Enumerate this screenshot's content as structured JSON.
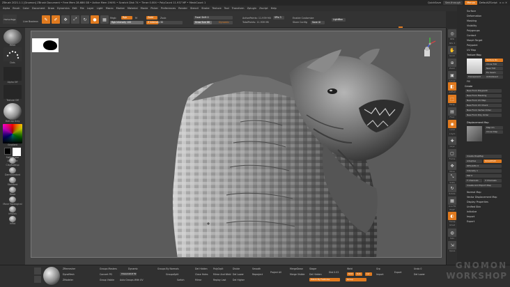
{
  "titlebar": {
    "title": "ZBrush 2021.1.1 [Gnomon]   ZBrush Document   • Free Mem 28.686 GB • Active Mem 19491 • Scratch Disk 74 • Timer 0.004 • PolyCount 11.937 MP • MeshCount 1",
    "quicksave": "QuickSave",
    "transparency": "See-through",
    "menus_btn": "Menus",
    "script": "DefaultZScript"
  },
  "menubar": [
    "Alpha",
    "Brush",
    "Color",
    "Document",
    "Draw",
    "Dynamics",
    "Edit",
    "File",
    "Layer",
    "Light",
    "Macro",
    "Marker",
    "Material",
    "Movie",
    "Picker",
    "Preferences",
    "Render",
    "Stencil",
    "Stroke",
    "Texture",
    "Tool",
    "Transform",
    "Zplugin",
    "Zscript",
    "Help"
  ],
  "topbar": {
    "home": "Home Page",
    "lightbox": "LightBox",
    "live_boolean": "Live Boolean",
    "edit": "Edit",
    "draw": "Draw",
    "move": "Move",
    "scale": "Scale",
    "rotate": "Rotate",
    "mrgb": "Mrgb",
    "rgb": "Rgb",
    "m": "M",
    "rgb_intensity": "Rgb Intensity 100",
    "zadd": "Zadd",
    "zsub": "Zsub",
    "z_intensity": "Z Intensity 32",
    "focal_shift": "Focal Shift 0",
    "draw_size": "Draw Size 86",
    "dynamic": "Dynamic",
    "active_points": "ActivePoints: 11.939 Mil",
    "total_points": "TotalPoints: 11.939 Mil",
    "spix": "SPix 3",
    "enable_customize": "Enable Customize",
    "store_config": "Store Config",
    "save_ui": "Save UI",
    "lightbox_btn": "LightBox"
  },
  "lefttray": {
    "brush": "Move",
    "stroke": "Dots",
    "alpha": "Alpha Off",
    "texture": "Texture Off",
    "material": "MatCap Gray",
    "gradient": "Gradient",
    "switch_color": "SwitchColor",
    "alternate": "Alternate",
    "brushes": [
      "ClayBuildup",
      "DamStandard",
      "Standard",
      "Move",
      "Move Topological",
      "hPolish",
      "Inflat"
    ]
  },
  "rightstrip": [
    "BPR",
    "SPix 3",
    "Scroll",
    "Zoom",
    "Actual",
    "AAHalf",
    "Persp",
    "Floor",
    "Local",
    "L.Sym",
    "Gxyz",
    "Frame",
    "Move",
    "Scale",
    "Rotate",
    "Line Fill",
    "PolyF",
    "Transp",
    "Ghost",
    "Solo",
    "Xpose"
  ],
  "rightpanel": {
    "items": [
      "Surface",
      "Deformation",
      "Masking",
      "Visibility",
      "Polygroups",
      "Contact",
      "Morph Target",
      "Polypaint",
      "UV Map"
    ],
    "texture_map": "Texture Map",
    "texture_on": "Texture On",
    "clone_txtr": "Clone Txtr",
    "new_txtr": "New Txtr",
    "fix_seam": "Fix Seam",
    "transparent": "Transparent",
    "antialiased": "Antialiased",
    "fill": "Fill",
    "create": "Create",
    "create_items": [
      "New From Polypaint",
      "New From Masking",
      "New From UV Map",
      "New From UV Check",
      "New From Vertex Order",
      "New From Poly Order"
    ],
    "displacement_map": "Displacement Map",
    "map_on": "Map On",
    "clone_disp": "Clone Disp",
    "create_dispmap": "Create DispMap",
    "mode": "Mode",
    "adaptive": "Adaptive",
    "smooth_uv": "SmoothUV",
    "dpsubpix": "DPSubPix 0",
    "intensity": "Intensity 1",
    "mid": "Mid 0",
    "f_channels": "F Channels",
    "channels_val": "3 Channels",
    "create_all": "Create And Export Map",
    "normal_map": "Normal Map",
    "vector_disp": "Vector Displacement Map",
    "display_props": "Display Properties",
    "unified_skin": "Unified Skin",
    "initialize": "Initialize",
    "import": "Import",
    "export": "Export"
  },
  "bottomshelf": {
    "col1": [
      "ZRemesher",
      "DynaMesh",
      "ZModeler"
    ],
    "col2": [
      "Groups Masters",
      "Convert PG",
      "Group Visible"
    ],
    "col3": [
      "Dynamic",
      "ClassicalLR 52",
      "Auto Groups With UV"
    ],
    "col4": [
      "Groups By Normals",
      "GroupsSplit",
      "Switch"
    ],
    "col5": [
      "Del Hidden",
      "Mirror",
      "Close Holes"
    ],
    "col6": [
      "PolyGrpIt",
      "Mirror And Weld",
      "Replay Last"
    ],
    "col7": [
      "Divide",
      "Del Lower",
      "Del Higher"
    ],
    "col8": [
      "Smooth",
      "Reproject"
    ],
    "col9": [
      "Project All",
      "MergeDown",
      "Merge Visible"
    ],
    "col10": [
      "Stager",
      "Del Hidden",
      "Polish By Features"
    ],
    "col11": [
      "Dist 0.02",
      "Smt",
      "Sub",
      "Lvl"
    ],
    "col12": [
      "Weld",
      "Grp",
      "Group"
    ],
    "col13": [
      "Import",
      "Export"
    ],
    "col14": [
      "Undo 0",
      "Del Lower"
    ]
  },
  "watermark": [
    "GNOMON",
    "WORKSHOP"
  ]
}
